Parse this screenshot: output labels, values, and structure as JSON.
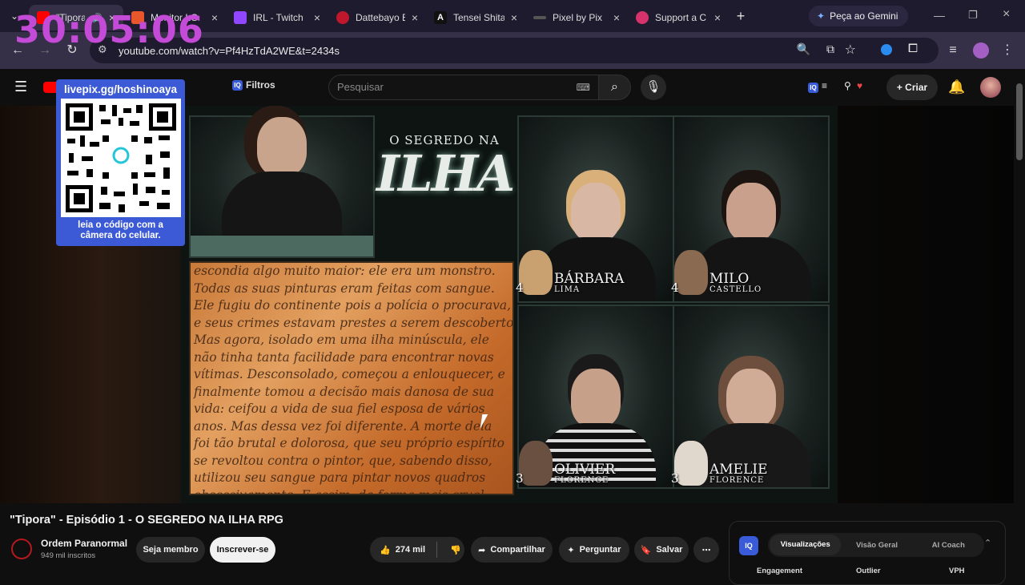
{
  "timer": "30:05:06",
  "tabs": [
    {
      "label": "\"Tipora\"",
      "color": "#ff0000"
    },
    {
      "label": "Monitor LG",
      "color": "#e8572c"
    },
    {
      "label": "IRL - Twitch",
      "color": "#9146ff"
    },
    {
      "label": "Dattebayo E",
      "color": "#c0172c"
    },
    {
      "label": "Tensei Shita",
      "color": "#111111"
    },
    {
      "label": "Pixel by Pix",
      "color": "#555555"
    },
    {
      "label": "Support a C",
      "color": "#d6336c"
    }
  ],
  "gemini_button": "Peça ao Gemini",
  "address_bar": "youtube.com/watch?v=Pf4HzTdA2WE&t=2434s",
  "youtube": {
    "filters_label": "Filtros",
    "search_placeholder": "Pesquisar",
    "create_label": "Criar"
  },
  "overlay": {
    "url": "livepix.gg/hoshinoaya",
    "caption_line1": "leia o código com a",
    "caption_line2": "câmera do celular."
  },
  "stream": {
    "logo_top": "O SEGREDO NA",
    "logo_main": "ILHA",
    "letter_lines": [
      "escondia algo muito maior: ele era um monstro.",
      "Todas as suas pinturas eram feitas com sangue.",
      "Ele fugiu do continente pois a polícia o procurava,",
      "e seus crimes estavam prestes a serem descobertos.",
      "Mas agora, isolado em uma ilha minúscula, ele",
      "não tinha tanta facilidade para encontrar novas",
      "vítimas. Desconsolado, começou a enlouquecer, e",
      "finalmente tomou a decisão mais danosa de sua",
      "vida: ceifou a vida de sua fiel esposa de vários",
      "anos. Mas dessa vez foi diferente. A morte dela",
      "foi tão brutal e dolorosa, que seu próprio espírito",
      "se revoltou contra o pintor, que, sabendo disso,",
      "utilizou seu sangue para pintar novos quadros",
      "obsessivamente. E assim, da forma mais cruel"
    ],
    "players": [
      {
        "first": "BÁRBARA",
        "last": "LIMA",
        "num": "4"
      },
      {
        "first": "MILO",
        "last": "CASTELLO",
        "num": "4"
      },
      {
        "first": "OLIVIER",
        "last": "FLORENCE",
        "num": "3"
      },
      {
        "first": "AMELIE",
        "last": "FLORENCE",
        "num": "3"
      }
    ]
  },
  "video": {
    "title": "\"Tipora\" - Episódio 1 - O SEGREDO NA ILHA RPG",
    "channel": "Ordem Paranormal",
    "subscribers": "949 mil inscritos",
    "join_label": "Seja membro",
    "subscribe_label": "Inscrever-se",
    "likes": "274 mil",
    "share_label": "Compartilhar",
    "ask_label": "Perguntar",
    "save_label": "Salvar"
  },
  "iq_panel": {
    "logo": "IQ",
    "tabs": [
      "Visualizações",
      "Visão Geral",
      "AI Coach"
    ],
    "columns": [
      "Engagement",
      "Outlier",
      "VPH"
    ]
  }
}
